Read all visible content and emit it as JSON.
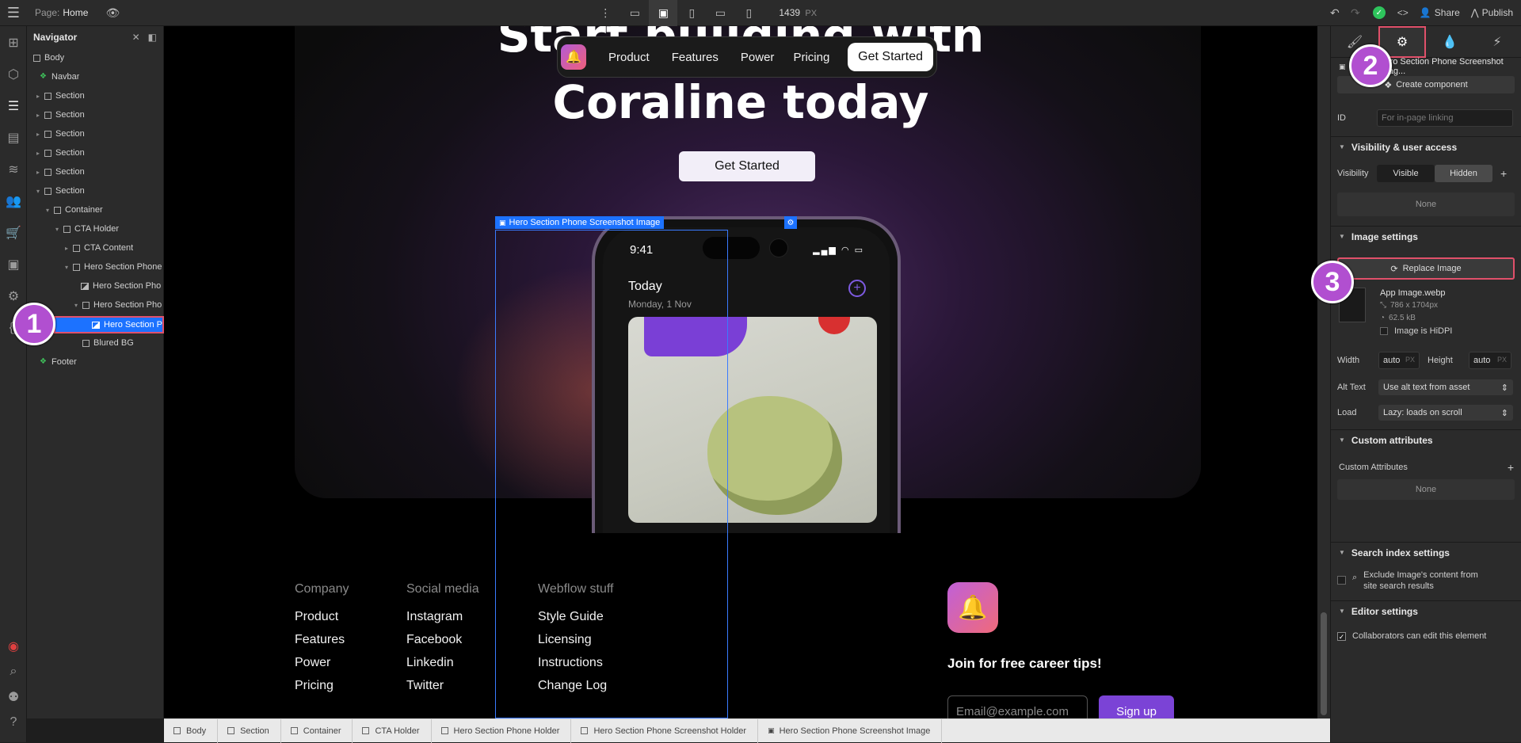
{
  "topbar": {
    "page_prefix": "Page:",
    "page_name": "Home",
    "viewport_width": "1439",
    "viewport_unit": "PX",
    "share_label": "Share",
    "publish_label": "Publish"
  },
  "navigator": {
    "title": "Navigator",
    "items": [
      {
        "label": "Body"
      },
      {
        "label": "Navbar"
      },
      {
        "label": "Section"
      },
      {
        "label": "Section"
      },
      {
        "label": "Section"
      },
      {
        "label": "Section"
      },
      {
        "label": "Section"
      },
      {
        "label": "Section"
      },
      {
        "label": "Container"
      },
      {
        "label": "CTA Holder"
      },
      {
        "label": "CTA Content"
      },
      {
        "label": "Hero Section Phone"
      },
      {
        "label": "Hero Section Pho"
      },
      {
        "label": "Hero Section Pho"
      },
      {
        "label": "Hero Section P"
      },
      {
        "label": "Blured BG"
      },
      {
        "label": "Footer"
      }
    ]
  },
  "canvas": {
    "hero_title_top": "Start building with",
    "hero_title_bottom": "Coraline today",
    "hero_button": "Get Started",
    "nav_links": [
      "Product",
      "Features",
      "Power",
      "Pricing"
    ],
    "nav_cta": "Get Started",
    "selection_label": "Hero Section Phone Screenshot Image",
    "phone": {
      "time": "9:41",
      "today": "Today",
      "date": "Monday, 1 Nov"
    },
    "footer": {
      "columns": [
        {
          "title": "Company",
          "links": [
            "Product",
            "Features",
            "Power",
            "Pricing"
          ]
        },
        {
          "title": "Social media",
          "links": [
            "Instagram",
            "Facebook",
            "Linkedin",
            "Twitter"
          ]
        },
        {
          "title": "Webflow stuff",
          "links": [
            "Style Guide",
            "Licensing",
            "Instructions",
            "Change Log"
          ]
        }
      ],
      "tagline": "Join for free career tips!",
      "email_placeholder": "Email@example.com",
      "signup_label": "Sign up"
    }
  },
  "right_panel": {
    "element_name": "Hero Section Phone Screenshot Imag...",
    "create_component": "Create component",
    "id_label": "ID",
    "id_placeholder": "For in-page linking",
    "visibility_section": "Visibility & user access",
    "visibility_label": "Visibility",
    "visible_option": "Visible",
    "hidden_option": "Hidden",
    "visibility_none": "None",
    "image_settings": "Image settings",
    "replace_image": "Replace Image",
    "file_name": "App Image.webp",
    "file_dims": "786 x 1704px",
    "file_size": "62.5 kB",
    "hidpi_label": "Image is HiDPI",
    "width_label": "Width",
    "width_value": "auto",
    "height_label": "Height",
    "height_value": "auto",
    "px_unit": "PX",
    "alt_label": "Alt Text",
    "alt_value": "Use alt text from asset",
    "load_label": "Load",
    "load_value": "Lazy: loads on scroll",
    "custom_attrs_section": "Custom attributes",
    "custom_attrs_label": "Custom Attributes",
    "custom_attrs_none": "None",
    "search_index_section": "Search index settings",
    "search_index_text_1": "Exclude Image's content from",
    "search_index_text_2": "site search results",
    "editor_section": "Editor settings",
    "editor_text": "Collaborators can edit this element"
  },
  "badges": [
    "1",
    "2",
    "3"
  ],
  "breadcrumb": [
    "Body",
    "Section",
    "Container",
    "CTA Holder",
    "Hero Section Phone Holder",
    "Hero Section Phone Screenshot Holder",
    "Hero Section Phone Screenshot Image"
  ],
  "colors": {
    "accent_blue": "#1c72ff",
    "badge_purple": "#b14fd0",
    "highlight_red": "#e0506a",
    "signup_purple": "#7b43d6",
    "status_green": "#2ec45c"
  }
}
